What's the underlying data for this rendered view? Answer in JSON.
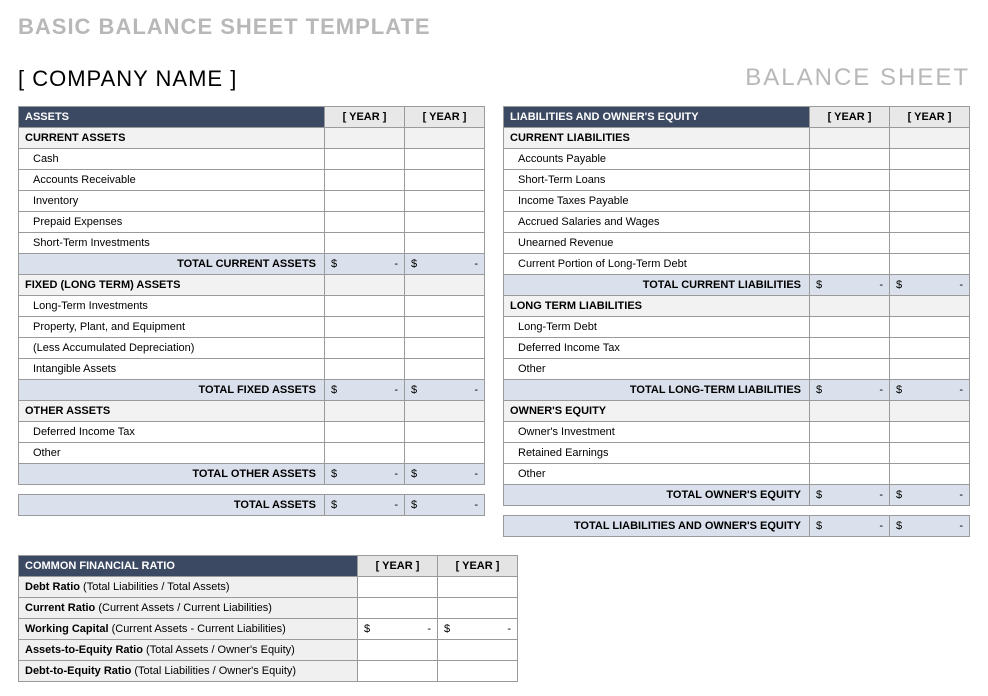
{
  "page_title": "BASIC BALANCE SHEET TEMPLATE",
  "company_name": "[ COMPANY NAME ]",
  "doc_title": "BALANCE SHEET",
  "year_header": "[ YEAR ]",
  "currency": "$",
  "dash": "-",
  "assets": {
    "header": "ASSETS",
    "current": {
      "header": "CURRENT ASSETS",
      "items": [
        "Cash",
        "Accounts Receivable",
        "Inventory",
        "Prepaid Expenses",
        "Short-Term Investments"
      ],
      "total_label": "TOTAL CURRENT ASSETS"
    },
    "fixed": {
      "header": "FIXED (LONG TERM) ASSETS",
      "items": [
        "Long-Term Investments",
        "Property, Plant, and Equipment",
        "(Less Accumulated Depreciation)",
        "Intangible Assets"
      ],
      "total_label": "TOTAL FIXED ASSETS"
    },
    "other": {
      "header": "OTHER ASSETS",
      "items": [
        "Deferred Income Tax",
        "Other"
      ],
      "total_label": "TOTAL OTHER ASSETS"
    },
    "grand_total": "TOTAL ASSETS"
  },
  "liabilities": {
    "header": "LIABILITIES AND OWNER'S EQUITY",
    "current": {
      "header": "CURRENT LIABILITIES",
      "items": [
        "Accounts Payable",
        "Short-Term Loans",
        "Income Taxes Payable",
        "Accrued Salaries and Wages",
        "Unearned Revenue",
        "Current Portion of Long-Term Debt"
      ],
      "total_label": "TOTAL CURRENT LIABILITIES"
    },
    "longterm": {
      "header": "LONG TERM LIABILITIES",
      "items": [
        "Long-Term Debt",
        "Deferred Income Tax",
        "Other"
      ],
      "total_label": "TOTAL LONG-TERM LIABILITIES"
    },
    "equity": {
      "header": "OWNER'S EQUITY",
      "items": [
        "Owner's Investment",
        "Retained Earnings",
        "Other"
      ],
      "total_label": "TOTAL OWNER'S EQUITY"
    },
    "grand_total": "TOTAL LIABILITIES AND OWNER'S EQUITY"
  },
  "ratios": {
    "header": "COMMON FINANCIAL RATIO",
    "rows": [
      {
        "name": "Debt Ratio",
        "desc": " (Total Liabilities / Total Assets)",
        "money": false
      },
      {
        "name": "Current Ratio",
        "desc": " (Current Assets / Current Liabilities)",
        "money": false
      },
      {
        "name": "Working Capital",
        "desc": " (Current Assets - Current Liabilities)",
        "money": true
      },
      {
        "name": "Assets-to-Equity Ratio",
        "desc": " (Total Assets / Owner's Equity)",
        "money": false
      },
      {
        "name": "Debt-to-Equity Ratio",
        "desc": " (Total Liabilities / Owner's Equity)",
        "money": false
      }
    ]
  }
}
